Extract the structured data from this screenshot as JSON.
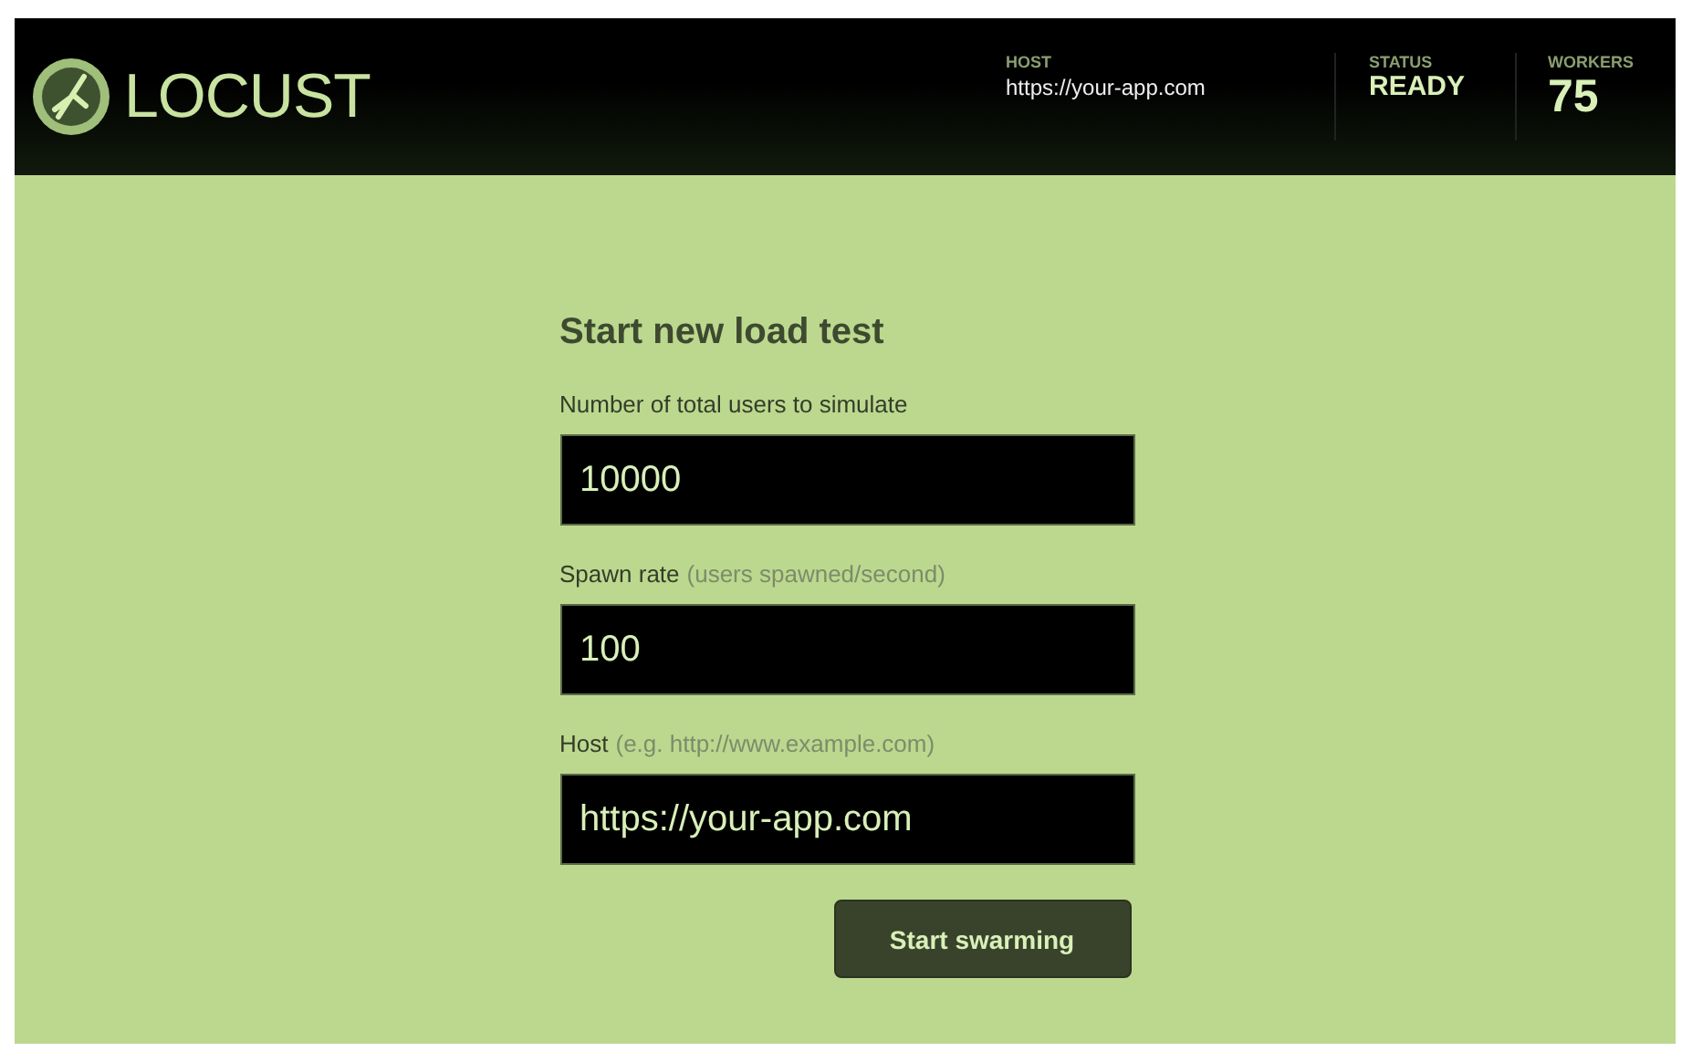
{
  "header": {
    "logo": "LOCUST",
    "stats": [
      {
        "label": "HOST",
        "value": "https://your-app.com",
        "kind": "small"
      },
      {
        "label": "STATUS",
        "value": "READY",
        "kind": "medium"
      },
      {
        "label": "WORKERS",
        "value": "75",
        "kind": "large"
      }
    ]
  },
  "form": {
    "title": "Start new load test",
    "fields": [
      {
        "label": "Number of total users to simulate",
        "value": "10000"
      },
      {
        "label": "Spawn rate",
        "hint": "(users spawned/second)",
        "value": "100"
      },
      {
        "label": "Host",
        "hint": "(e.g. http://www.example.com)",
        "value": "https://your-app.com"
      }
    ],
    "button": "Start swarming"
  }
}
